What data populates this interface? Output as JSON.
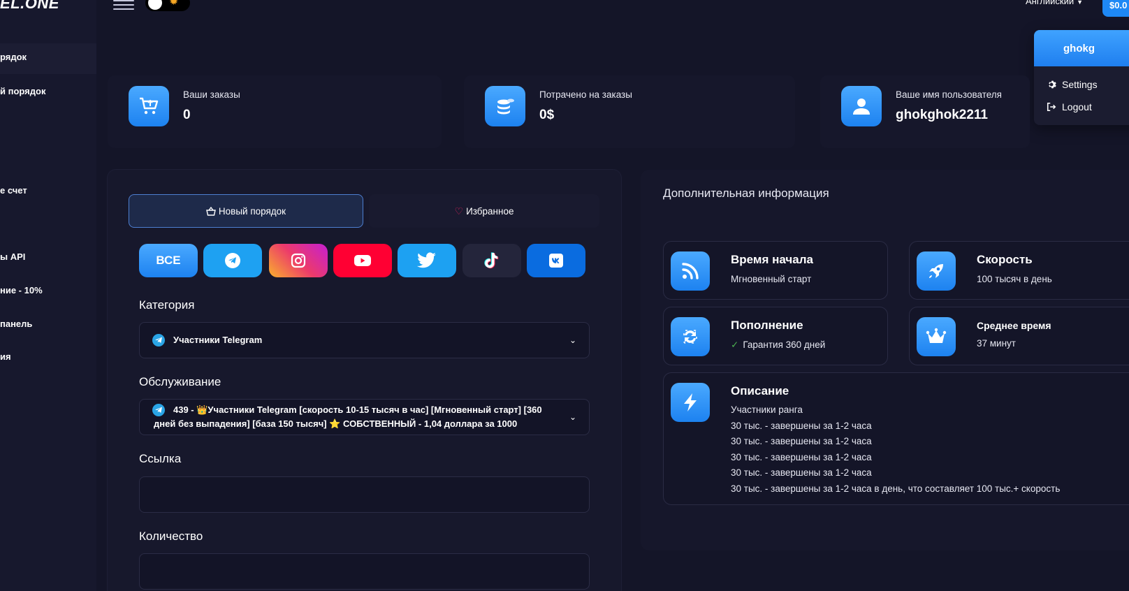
{
  "brand": {
    "logo_text": "EL.ONE"
  },
  "sidebar": {
    "items": [
      {
        "label": "рядок"
      },
      {
        "label": "й порядок"
      },
      {
        "label": "е счет"
      },
      {
        "label": "ы API"
      },
      {
        "label": "ние - 10%"
      },
      {
        "label": " панель"
      },
      {
        "label": "ия"
      }
    ]
  },
  "topbar": {
    "language": "Английский",
    "balance": "$0.0"
  },
  "user_menu": {
    "username": "ghokg",
    "settings_label": "Settings",
    "logout_label": "Logout"
  },
  "stats": [
    {
      "label": "Ваши заказы",
      "value": "0",
      "icon": "cart-icon"
    },
    {
      "label": "Потрачено на заказы",
      "value": "0$",
      "icon": "coins-icon"
    },
    {
      "label": "Ваше имя пользователя",
      "value": "ghokghok2211",
      "icon": "user-icon"
    }
  ],
  "order_form": {
    "tabs": {
      "new_order": "Новый порядок",
      "favorites": "Избранное"
    },
    "social_filters": {
      "all_label": "ВСЕ"
    },
    "category_label": "Категория",
    "category_value": "Участники Telegram",
    "service_label": "Обслуживание",
    "service_value_line1": "439 - 👑Участники Telegram [скорость 10-15 тысяч в час] [Мгновенный старт] [360",
    "service_value_line2": "дней без выпадения] [база 150 тысяч] ⭐ СОБСТВЕННЫЙ - 1,04 доллара за 1000",
    "link_label": "Ссылка",
    "link_value": "",
    "quantity_label": "Количество"
  },
  "info": {
    "title": "Дополнительная информация",
    "start_time": {
      "title": "Время начала",
      "sub": "Мгновенный старт"
    },
    "speed": {
      "title": "Скорость",
      "sub": "100 тысяч в день"
    },
    "refill": {
      "title": "Пополнение",
      "sub": "Гарантия 360 дней"
    },
    "avg_time": {
      "title": "Среднее время",
      "sub": "37 минут"
    },
    "description": {
      "title": "Описание",
      "lines": [
        "Участники ранга",
        "30 тыс. - завершены за 1-2 часа",
        "30 тыс. - завершены за 1-2 часа",
        "30 тыс. - завершены за 1-2 часа",
        "30 тыс. - завершены за 1-2 часа",
        "30 тыс. - завершены за 1-2 часа в день, что составляет 100 тыс.+ скорость"
      ]
    }
  },
  "colors": {
    "background": "#141528",
    "accent": "#1e88f5",
    "telegram": "#1ea1f2",
    "youtube": "#ff0033",
    "twitter": "#1da1f2",
    "vk": "#0a6ce0"
  }
}
